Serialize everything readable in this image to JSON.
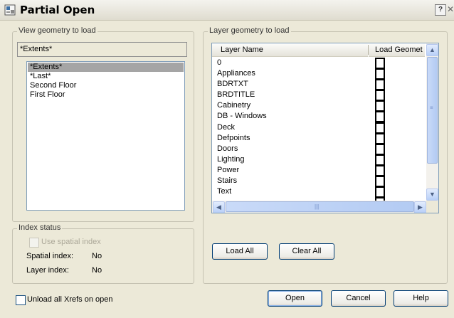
{
  "window": {
    "title": "Partial Open",
    "help_glyph": "?",
    "close_glyph": "✕"
  },
  "view_group": {
    "legend": "View geometry to load",
    "current_view": "*Extents*",
    "views": [
      "*Extents*",
      "*Last*",
      "Second Floor",
      "First Floor"
    ],
    "selected_index": 0
  },
  "index_group": {
    "legend": "Index status",
    "use_spatial_index_label": "Use spatial index",
    "spatial_index_label": "Spatial index:",
    "spatial_index_value": "No",
    "layer_index_label": "Layer index:",
    "layer_index_value": "No"
  },
  "layer_group": {
    "legend": "Layer geometry to load",
    "col_name": "Layer Name",
    "col_load": "Load Geomet",
    "layers": [
      "0",
      "Appliances",
      "BDRTXT",
      "BRDTITLE",
      "Cabinetry",
      "DB - Windows",
      "Deck",
      "Defpoints",
      "Doors",
      "Lighting",
      "Power",
      "Stairs",
      "Text"
    ],
    "load_all": "Load All",
    "clear_all": "Clear All",
    "scroll_up": "▲",
    "scroll_down": "▼",
    "scroll_left": "◀",
    "scroll_right": "▶",
    "grip": "|||",
    "vgrip": "≡"
  },
  "footer": {
    "unload_xrefs_label": "Unload all Xrefs on open",
    "open": "Open",
    "cancel": "Cancel",
    "help": "Help"
  }
}
